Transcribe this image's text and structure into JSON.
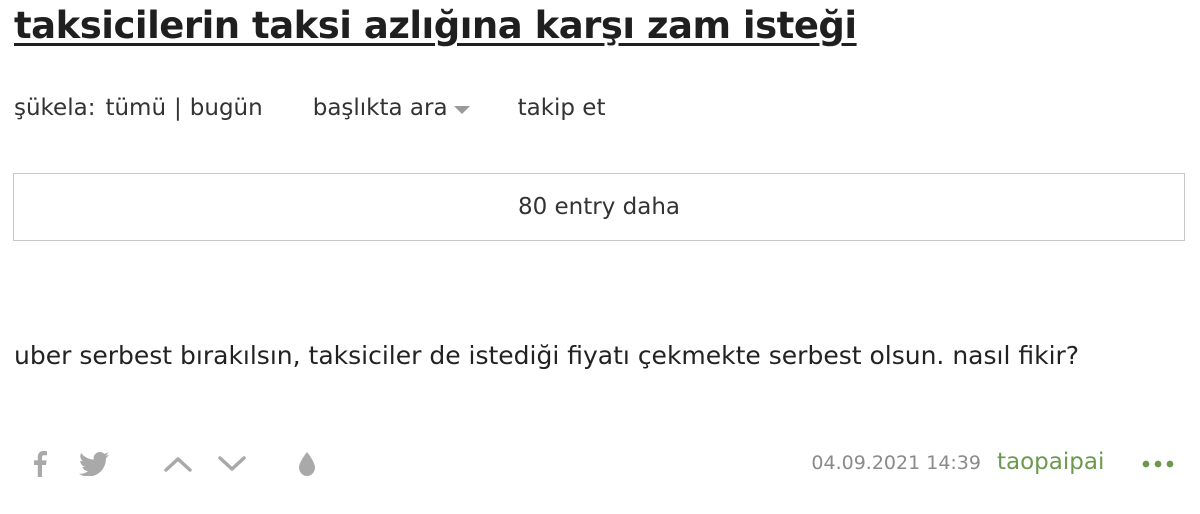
{
  "topic": {
    "title": "taksicilerin taksi azlığına karşı zam isteği"
  },
  "subnav": {
    "sukela_label": "şükela:",
    "all_label": "tümü",
    "separator": "|",
    "today_label": "bugün",
    "search_in_topic_label": "başlıkta ara",
    "follow_label": "takip et"
  },
  "more_entries": {
    "label": "80 entry daha"
  },
  "entry": {
    "content": "uber serbest bırakılsın, taksiciler de istediği fiyatı çekmekte serbest olsun. nasıl fikir?",
    "date": "04.09.2021 14:39",
    "author": "taopaipai"
  },
  "icons": {
    "facebook": "facebook-icon",
    "twitter": "twitter-icon",
    "upvote": "chevron-up-icon",
    "downvote": "chevron-down-icon",
    "favorite": "drop-icon",
    "more": "more-dots-icon"
  },
  "colors": {
    "author": "#6b9a4e",
    "icon_gray": "#a9a9a9",
    "more_dots": "#6b9a4e"
  }
}
